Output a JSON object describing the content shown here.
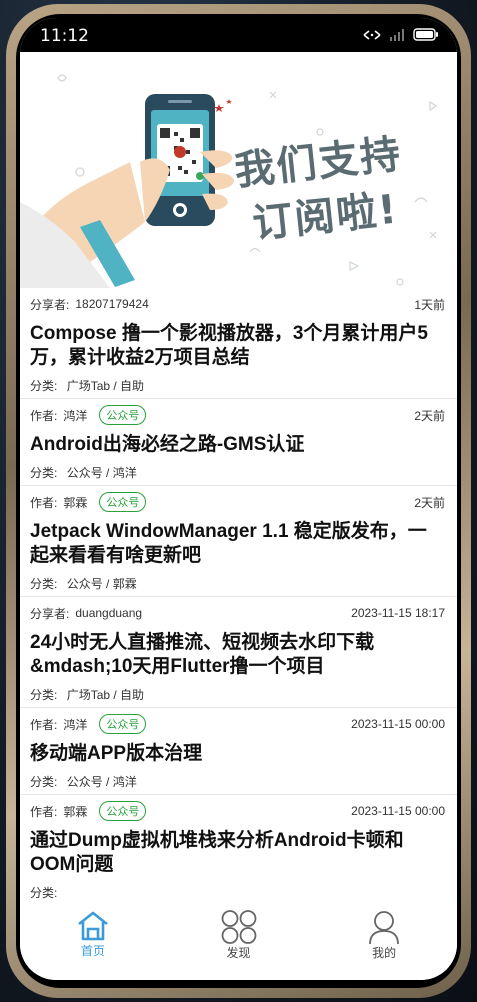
{
  "status": {
    "time": "11:12"
  },
  "banner": {
    "line1": "我们支持",
    "line2": "订阅啦!"
  },
  "articles": [
    {
      "author_label": "分享者:",
      "author": "18207179424",
      "tag": "",
      "time": "1天前",
      "title": "Compose 撸一个影视播放器，3个月累计用户5万，累计收益2万项目总结",
      "category_label": "分类:",
      "category": "广场Tab / 自助"
    },
    {
      "author_label": "作者:",
      "author": "鸿洋",
      "tag": "公众号",
      "time": "2天前",
      "title": "Android出海必经之路-GMS认证",
      "category_label": "分类:",
      "category": "公众号 / 鸿洋"
    },
    {
      "author_label": "作者:",
      "author": "郭霖",
      "tag": "公众号",
      "time": "2天前",
      "title": "Jetpack WindowManager 1.1 稳定版发布，一起来看看有啥更新吧",
      "category_label": "分类:",
      "category": "公众号 / 郭霖"
    },
    {
      "author_label": "分享者:",
      "author": "duangduang",
      "tag": "",
      "time": "2023-11-15 18:17",
      "title": "24小时无人直播推流、短视频去水印下载&mdash;10天用Flutter撸一个项目",
      "category_label": "分类:",
      "category": "广场Tab / 自助"
    },
    {
      "author_label": "作者:",
      "author": "鸿洋",
      "tag": "公众号",
      "time": "2023-11-15 00:00",
      "title": "移动端APP版本治理",
      "category_label": "分类:",
      "category": "公众号 / 鸿洋"
    },
    {
      "author_label": "作者:",
      "author": "郭霖",
      "tag": "公众号",
      "time": "2023-11-15 00:00",
      "title": "通过Dump虚拟机堆栈来分析Android卡顿和OOM问题",
      "category_label": "分类:",
      "category": ""
    }
  ],
  "tabs": [
    {
      "label": "首页",
      "icon": "home-icon",
      "active": true
    },
    {
      "label": "发现",
      "icon": "discover-icon",
      "active": false
    },
    {
      "label": "我的",
      "icon": "profile-icon",
      "active": false
    }
  ],
  "colors": {
    "accent": "#3a9bd6",
    "tag_green": "#2aa13b",
    "banner_text": "#5a6b72"
  }
}
